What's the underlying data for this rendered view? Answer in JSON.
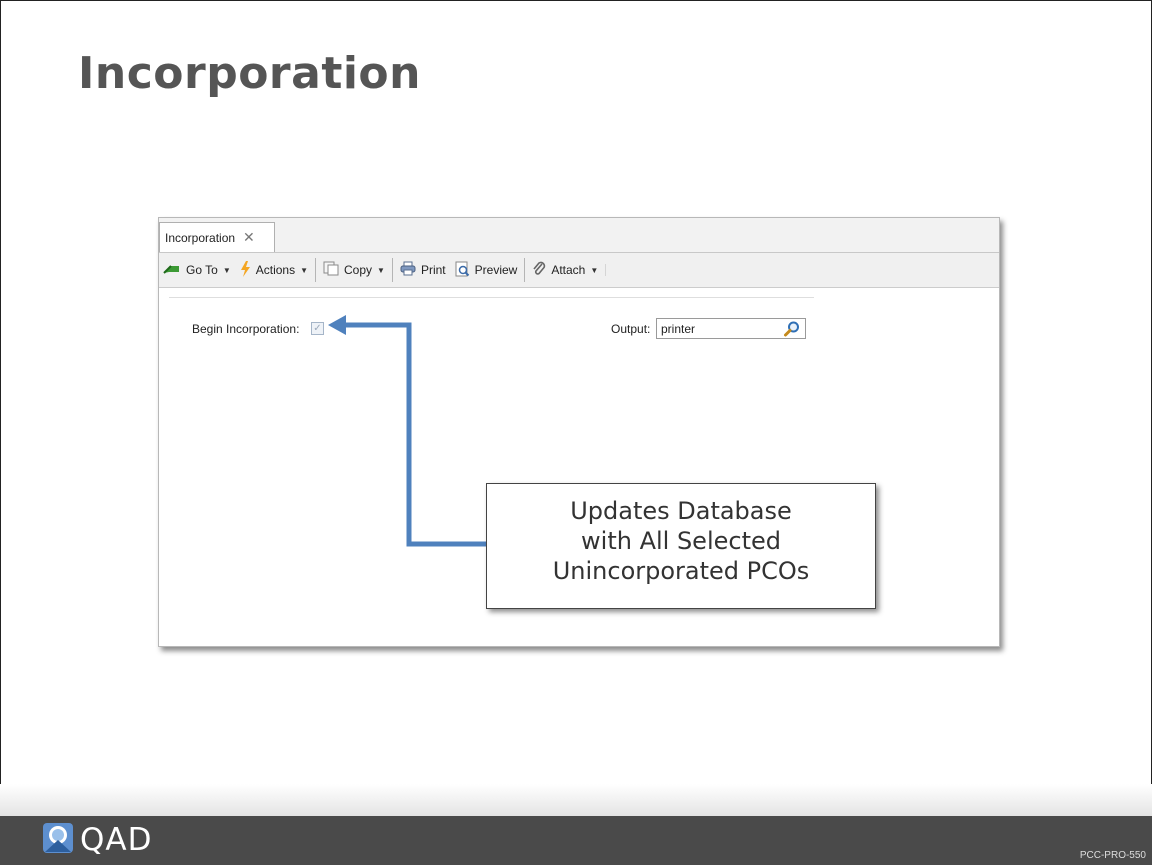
{
  "slide": {
    "title": "Incorporation",
    "code": "PCC-PRO-550"
  },
  "app": {
    "tab": {
      "label": "Incorporation",
      "close_icon": "close-icon"
    },
    "toolbar": {
      "goto_label": "Go To",
      "actions_label": "Actions",
      "copy_label": "Copy",
      "print_label": "Print",
      "preview_label": "Preview",
      "attach_label": "Attach"
    },
    "form": {
      "begin_label": "Begin Incorporation:",
      "begin_checked": true,
      "output_label": "Output:",
      "output_value": "printer"
    }
  },
  "callout": {
    "lines": [
      "Updates Database",
      "with All Selected",
      "Unincorporated PCOs"
    ]
  },
  "logo": {
    "text": "QAD"
  },
  "colors": {
    "arrow": "#4f81bd",
    "title": "#555555",
    "footer": "#4a4a4a"
  }
}
